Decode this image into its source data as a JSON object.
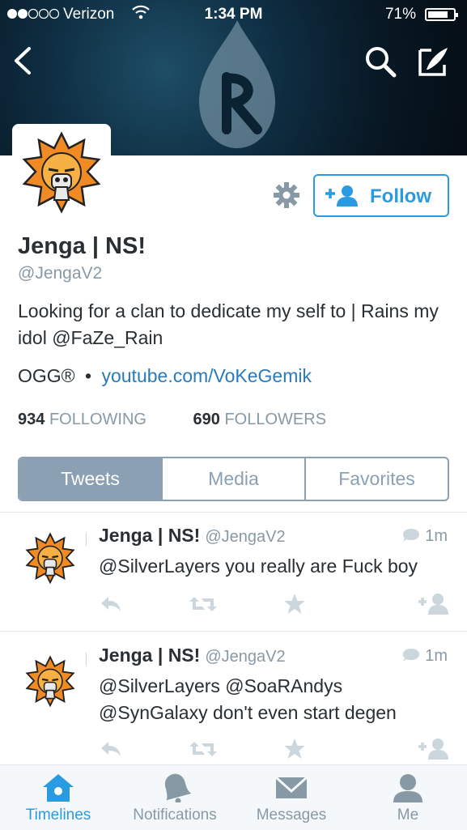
{
  "status_bar": {
    "carrier": "Verizon",
    "time": "1:34 PM",
    "battery": "71%"
  },
  "profile": {
    "name": "Jenga | NS!",
    "handle": "@JengaV2",
    "bio": "Looking for a clan to dedicate my self to | Rains my idol @FaZe_Rain",
    "location": "OGG®",
    "meta_separator": "•",
    "website": "youtube.com/VoKeGemik",
    "following_count": "934",
    "following_label": "FOLLOWING",
    "followers_count": "690",
    "followers_label": "FOLLOWERS",
    "follow_label": "Follow"
  },
  "profile_tabs": [
    "Tweets",
    "Media",
    "Favorites"
  ],
  "tweets": [
    {
      "name": "Jenga | NS!",
      "handle": "@JengaV2",
      "time": "1m",
      "text": "@SilverLayers you really are Fuck boy"
    },
    {
      "name": "Jenga | NS!",
      "handle": "@JengaV2",
      "time": "1m",
      "text": "@SilverLayers @SoaRAndys @SynGalaxy don't even start degen"
    }
  ],
  "tab_bar": {
    "timelines": "Timelines",
    "notifications": "Notifications",
    "messages": "Messages",
    "me": "Me"
  },
  "icons": [
    "back-icon",
    "search-icon",
    "compose-icon",
    "gear-icon",
    "add-user-icon",
    "reply-icon",
    "retweet-icon",
    "favorite-icon",
    "follow-icon",
    "reply-bubble-icon",
    "home-icon",
    "bell-icon",
    "envelope-icon",
    "person-icon"
  ],
  "colors": {
    "accent": "#2b9be1",
    "tab_active": "#8ca0b3",
    "link": "#2b7bb9",
    "muted": "#8899a6"
  }
}
